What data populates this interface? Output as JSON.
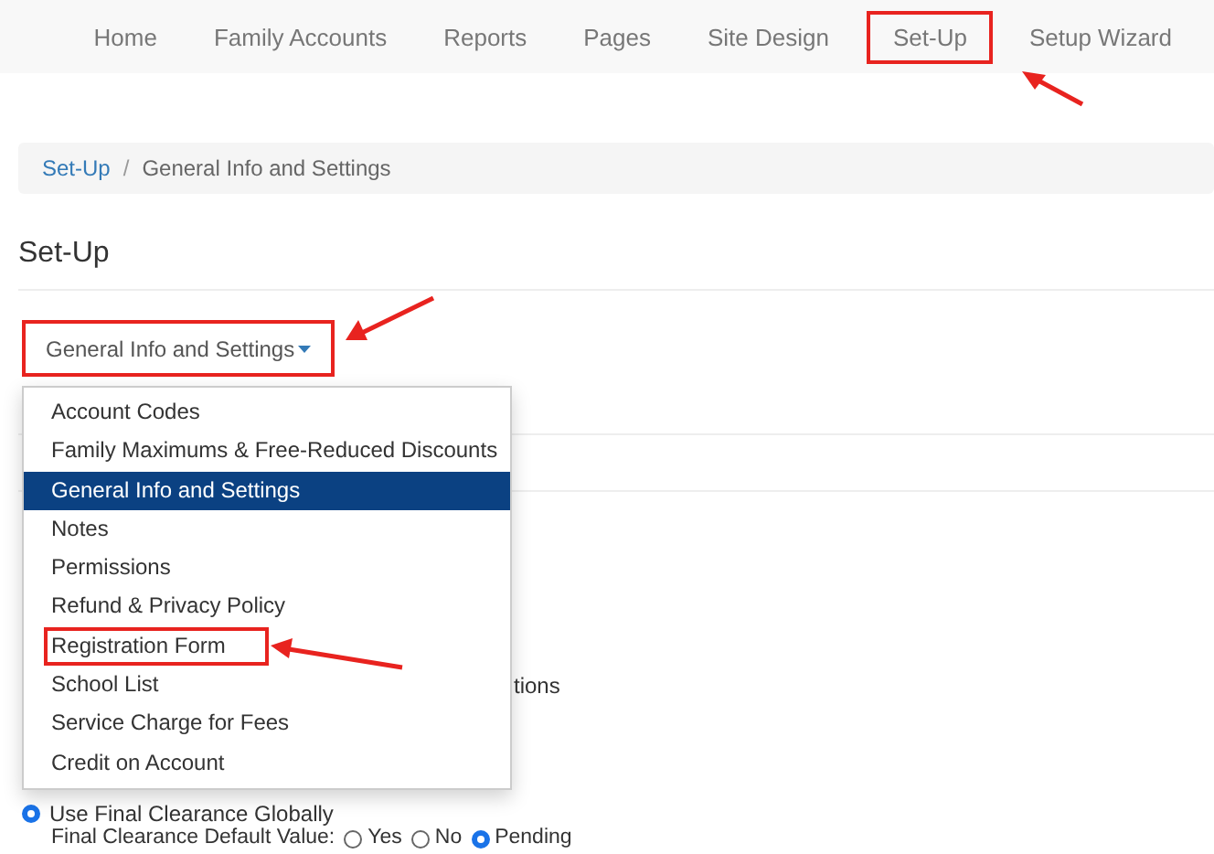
{
  "nav": [
    {
      "label": "Home",
      "highlighted": false
    },
    {
      "label": "Family Accounts",
      "highlighted": false
    },
    {
      "label": "Reports",
      "highlighted": false
    },
    {
      "label": "Pages",
      "highlighted": false
    },
    {
      "label": "Site Design",
      "highlighted": false
    },
    {
      "label": "Set-Up",
      "highlighted": true
    },
    {
      "label": "Setup Wizard",
      "highlighted": false
    }
  ],
  "breadcrumb": [
    {
      "label": "Set-Up",
      "kind": "link"
    },
    {
      "label": "/",
      "kind": "separator"
    },
    {
      "label": "General Info and Settings",
      "kind": "current"
    }
  ],
  "page_title": "Set-Up",
  "section_dropdown": {
    "label": "General Info and Settings",
    "expanded": true,
    "highlighted": true,
    "items": [
      {
        "label": "Account Codes",
        "selected": false,
        "highlighted": false
      },
      {
        "label": "Family Maximums & Free-Reduced Discounts",
        "selected": false,
        "highlighted": false
      },
      {
        "label": "General Info and Settings",
        "selected": true,
        "highlighted": false
      },
      {
        "label": "Notes",
        "selected": false,
        "highlighted": false
      },
      {
        "label": "Permissions",
        "selected": false,
        "highlighted": false
      },
      {
        "label": "Refund & Privacy Policy",
        "selected": false,
        "highlighted": false
      },
      {
        "label": "Registration Form",
        "selected": false,
        "highlighted": true
      },
      {
        "label": "School List",
        "selected": false,
        "highlighted": false
      },
      {
        "label": "Service Charge for Fees",
        "selected": false,
        "highlighted": false
      },
      {
        "label": "Credit on Account",
        "selected": false,
        "highlighted": false
      }
    ]
  },
  "covered_text": "tions",
  "final_clearance": {
    "global_option": {
      "label": "Use Final Clearance Globally",
      "selected": true
    },
    "default_value": {
      "label": "Final Clearance Default Value:",
      "options": [
        {
          "label": "Yes",
          "selected": false
        },
        {
          "label": "No",
          "selected": false
        },
        {
          "label": "Pending",
          "selected": true
        }
      ]
    }
  }
}
